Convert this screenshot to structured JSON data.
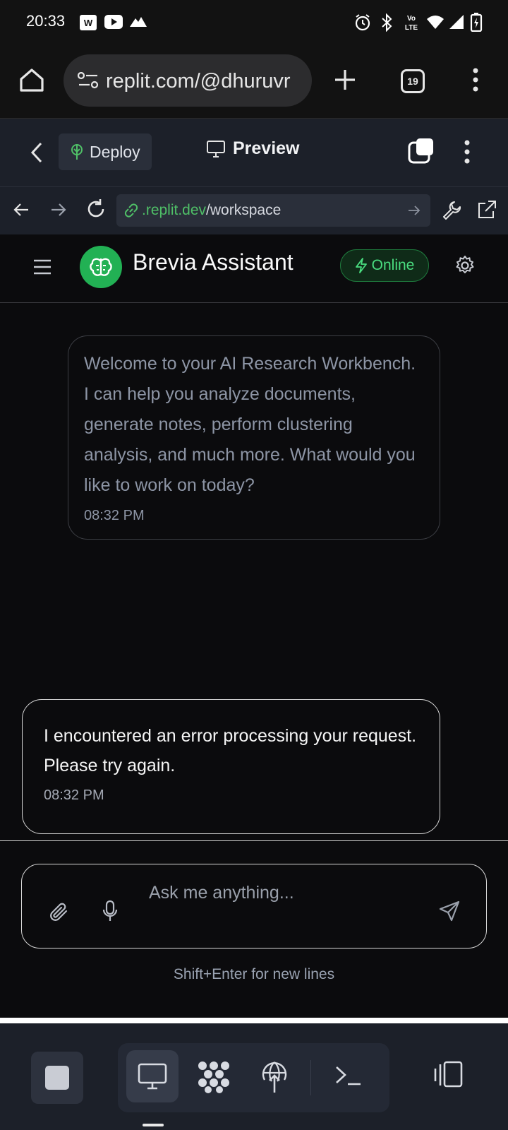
{
  "status_bar": {
    "time": "20:33",
    "battery_charging": true
  },
  "browser": {
    "url": "replit.com/@dhuruvr",
    "tab_count": "19"
  },
  "replit": {
    "deploy_label": "Deploy",
    "preview_label": "Preview",
    "dev_url_domain": ".replit.dev",
    "dev_url_path": "/workspace"
  },
  "app": {
    "title": "Brevia Assistant",
    "status": "Online",
    "accent": "#22b154"
  },
  "messages": [
    {
      "text": "Welcome to your AI Research Workbench. I can help you analyze documents, generate notes, perform clustering analysis, and much more. What would you like to work on today?",
      "time": "08:32 PM"
    },
    {
      "text": "I encountered an error processing your request. Please try again.",
      "time": "08:32 PM"
    }
  ],
  "composer": {
    "placeholder": "Ask me anything...",
    "hint": "Shift+Enter for new lines"
  }
}
